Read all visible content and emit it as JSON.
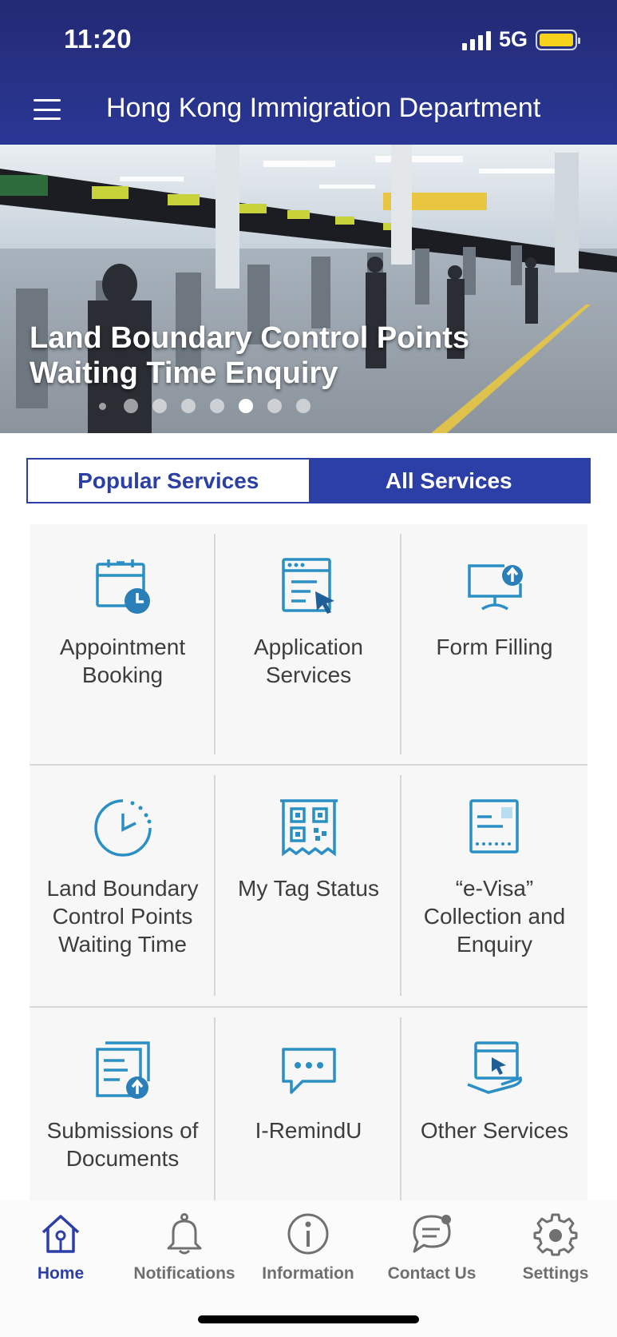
{
  "status_bar": {
    "time": "11:20",
    "network": "5G"
  },
  "header": {
    "title": "Hong Kong Immigration Department"
  },
  "banner": {
    "caption": "Land Boundary Control Points Waiting Time Enquiry",
    "slide_count": 8,
    "active_slide": 6
  },
  "tabs": {
    "popular": "Popular Services",
    "all": "All Services",
    "selected": "all"
  },
  "services": [
    {
      "label": "Appointment Booking",
      "icon": "calendar-clock-icon"
    },
    {
      "label": "Application Services",
      "icon": "form-cursor-icon"
    },
    {
      "label": "Form Filling",
      "icon": "monitor-upload-icon"
    },
    {
      "label": "Land Boundary Control Points Waiting Time",
      "icon": "timer-icon"
    },
    {
      "label": "My Tag Status",
      "icon": "qr-tag-icon"
    },
    {
      "label": "“e-Visa” Collection and Enquiry",
      "icon": "e-visa-icon"
    },
    {
      "label": "Submissions of Documents",
      "icon": "document-upload-icon"
    },
    {
      "label": "I-RemindU",
      "icon": "chat-bubble-icon"
    },
    {
      "label": "Other Services",
      "icon": "hand-screen-icon"
    }
  ],
  "bottom_nav": [
    {
      "label": "Home",
      "icon": "home-icon",
      "active": true
    },
    {
      "label": "Notifications",
      "icon": "bell-icon",
      "active": false
    },
    {
      "label": "Information",
      "icon": "info-icon",
      "active": false
    },
    {
      "label": "Contact Us",
      "icon": "chat-icon",
      "active": false
    },
    {
      "label": "Settings",
      "icon": "gear-icon",
      "active": false
    }
  ],
  "colors": {
    "header": "#232a74",
    "accent": "#2c3fa6",
    "icon_blue": "#2a8fc4"
  }
}
